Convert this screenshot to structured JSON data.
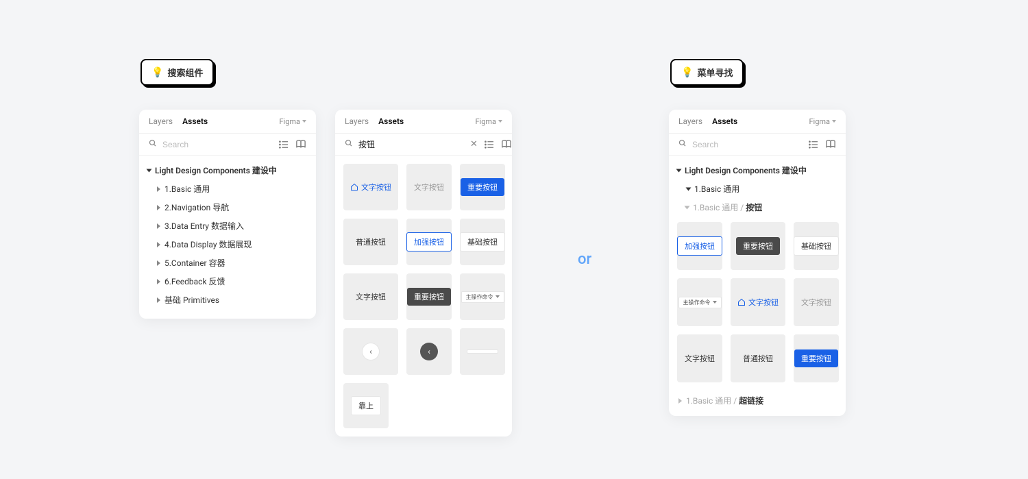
{
  "tag1": "搜索组件",
  "tag2": "菜单寻找",
  "or": "or",
  "panel1": {
    "tabs": {
      "layers": "Layers",
      "assets": "Assets"
    },
    "dropdown": "Figma",
    "search_placeholder": "Search",
    "tree_root": "Light Design Components 建设中",
    "items": [
      "1.Basic 通用",
      "2.Navigation 导航",
      "3.Data Entry 数据输入",
      "4.Data Display 数据展现",
      "5.Container 容器",
      "6.Feedback 反馈",
      "基础 Primitives"
    ]
  },
  "panel2": {
    "tabs": {
      "layers": "Layers",
      "assets": "Assets"
    },
    "dropdown": "Figma",
    "search_value": "按钮",
    "tiles": {
      "t1": "文字按钮",
      "t2": "文字按钮",
      "t3": "重要按钮",
      "t4": "普通按钮",
      "t5": "加强按钮",
      "t6": "基础按钮",
      "t7": "文字按钮",
      "t8": "重要按钮",
      "t9": "主操作命令",
      "t10_arrow": "‹",
      "t11_arrow": "‹",
      "t13": "靠上"
    }
  },
  "panel3": {
    "tabs": {
      "layers": "Layers",
      "assets": "Assets"
    },
    "dropdown": "Figma",
    "search_placeholder": "Search",
    "tree_root": "Light Design Components 建设中",
    "tree_l1": "1.Basic 通用",
    "tree_l2_prefix": "1.Basic 通用 / ",
    "tree_l2_bold": "按钮",
    "tiles": {
      "t1": "加强按钮",
      "t2": "重要按钮",
      "t3": "基础按钮",
      "t4": "主操作命令",
      "t5": "文字按钮",
      "t6": "文字按钮",
      "t7": "文字按钮",
      "t8": "普通按钮",
      "t9": "重要按钮"
    },
    "link_prefix": "1.Basic 通用 / ",
    "link_bold": "超链接"
  }
}
